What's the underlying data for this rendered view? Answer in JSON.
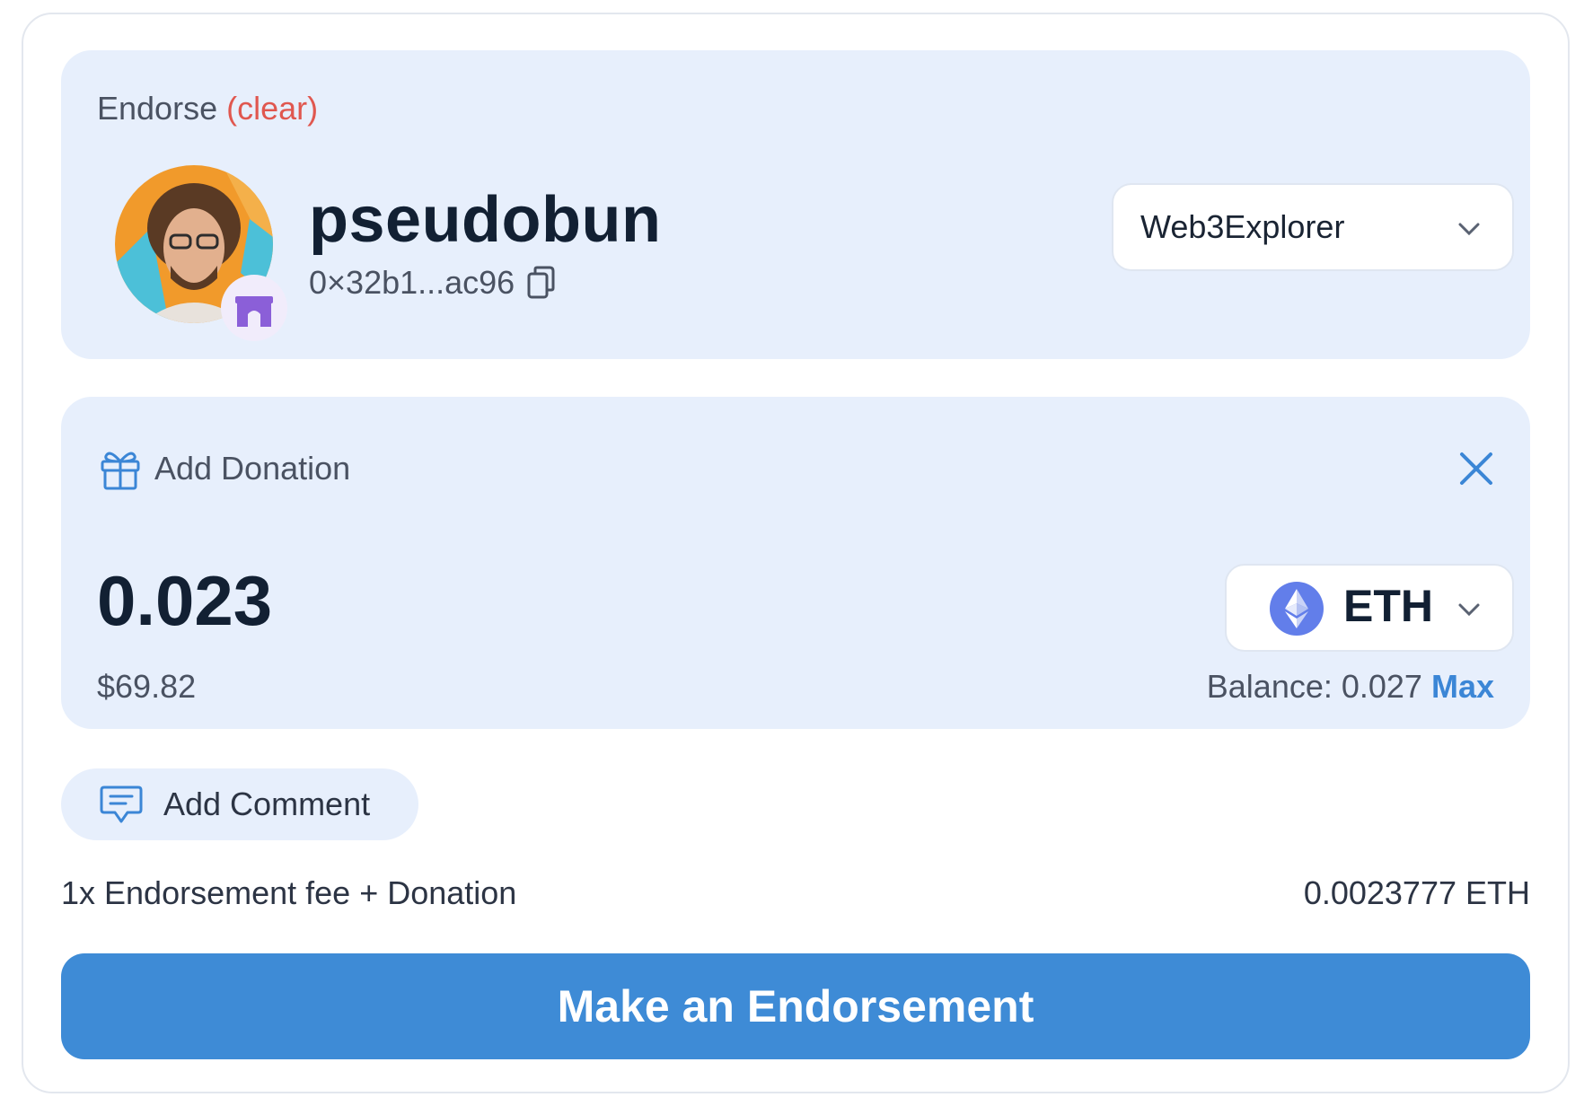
{
  "endorse": {
    "label": "Endorse",
    "clear_label": "(clear)",
    "username": "pseudobun",
    "address": "0×32b1...ac96",
    "profile_select": {
      "selected": "Web3Explorer"
    }
  },
  "donation": {
    "title": "Add Donation",
    "amount": "0.023",
    "usd_value": "$69.82",
    "token": "ETH",
    "balance_label": "Balance: 0.027",
    "max_label": "Max"
  },
  "comment": {
    "label": "Add Comment"
  },
  "fee": {
    "label": "1x Endorsement fee + Donation",
    "value": "0.0023777 ETH"
  },
  "cta": {
    "label": "Make an Endorsement"
  },
  "colors": {
    "accent": "#3e8bd6",
    "panel": "#e7effc",
    "clear": "#e0574f",
    "eth": "#627eea"
  }
}
